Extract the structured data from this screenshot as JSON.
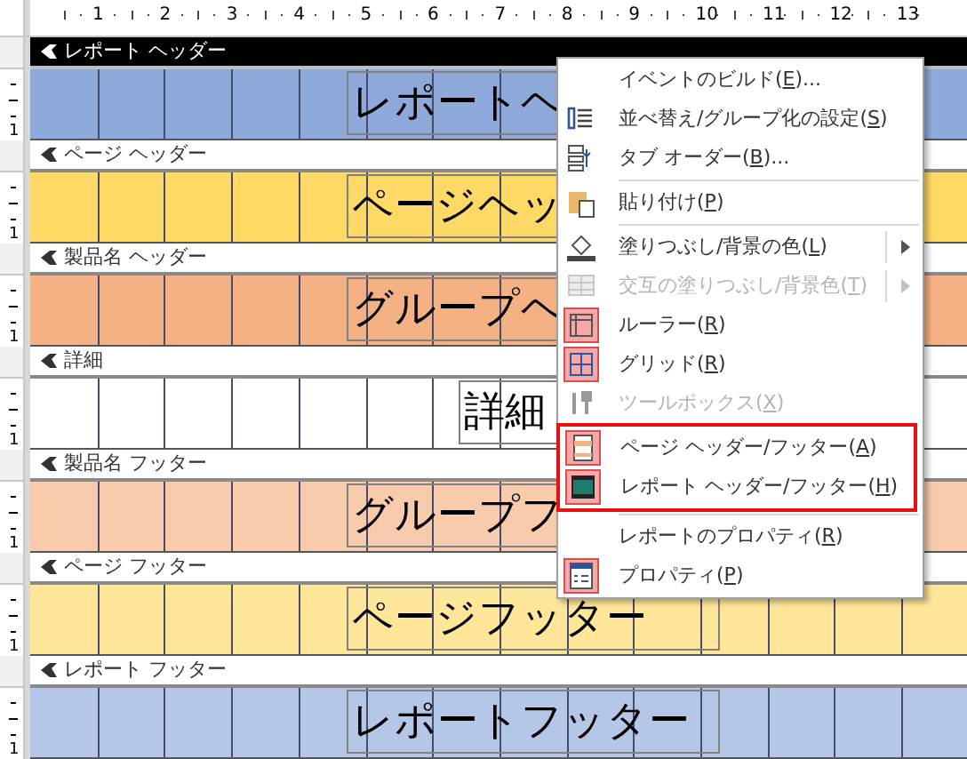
{
  "ruler": {
    "numbers": [
      "1",
      "2",
      "3",
      "4",
      "5",
      "6",
      "7",
      "8",
      "9",
      "10",
      "11",
      "12",
      "13"
    ]
  },
  "sections": [
    {
      "title": "レポート ヘッダー",
      "selected": true,
      "color": "#8eaadb",
      "label": "レポートヘ",
      "ruler_mark": "1"
    },
    {
      "title": "ページ ヘッダー",
      "selected": false,
      "color": "#ffd966",
      "label": "ページヘッ",
      "ruler_mark": "1"
    },
    {
      "title": "製品名 ヘッダー",
      "selected": false,
      "color": "#f4b183",
      "label": "グループヘ",
      "ruler_mark": "1"
    },
    {
      "title": "詳細",
      "selected": false,
      "color": "#ffffff",
      "label": "詳細",
      "ruler_mark": "1"
    },
    {
      "title": "製品名 フッター",
      "selected": false,
      "color": "#f8cbad",
      "label": "グループフ",
      "ruler_mark": "1"
    },
    {
      "title": "ページ フッター",
      "selected": false,
      "color": "#ffe699",
      "label": "ページフッター",
      "ruler_mark": "1"
    },
    {
      "title": "レポート フッター",
      "selected": false,
      "color": "#b4c7e7",
      "label": "レポートフッター",
      "ruler_mark": "1"
    }
  ],
  "context_menu": {
    "items": [
      {
        "kind": "item",
        "label": "イベントのビルド(",
        "key": "E",
        "suffix": ")...",
        "checked": false,
        "disabled": false,
        "submenu": false,
        "highlighted": false
      },
      {
        "kind": "item",
        "label": "並べ替え/グループ化の設定(",
        "key": "S",
        "suffix": ")",
        "checked": false,
        "disabled": false,
        "submenu": false,
        "highlighted": false
      },
      {
        "kind": "item",
        "label": "タブ オーダー(",
        "key": "B",
        "suffix": ")...",
        "checked": false,
        "disabled": false,
        "submenu": false,
        "highlighted": false
      },
      {
        "kind": "separator"
      },
      {
        "kind": "item",
        "label": "貼り付け(",
        "key": "P",
        "suffix": ")",
        "checked": false,
        "disabled": false,
        "submenu": false,
        "highlighted": false
      },
      {
        "kind": "separator"
      },
      {
        "kind": "item",
        "label": "塗りつぶし/背景の色(",
        "key": "L",
        "suffix": ")",
        "checked": false,
        "disabled": false,
        "submenu": true,
        "highlighted": false
      },
      {
        "kind": "item",
        "label": "交互の塗りつぶし/背景色(",
        "key": "T",
        "suffix": ")",
        "checked": false,
        "disabled": true,
        "submenu": true,
        "highlighted": false
      },
      {
        "kind": "item",
        "label": "ルーラー(",
        "key": "R",
        "suffix": ")",
        "checked": true,
        "disabled": false,
        "submenu": false,
        "highlighted": false
      },
      {
        "kind": "item",
        "label": "グリッド(",
        "key": "R",
        "suffix": ")",
        "checked": true,
        "disabled": false,
        "submenu": false,
        "highlighted": false
      },
      {
        "kind": "item",
        "label": "ツールボックス(",
        "key": "X",
        "suffix": ")",
        "checked": false,
        "disabled": true,
        "submenu": false,
        "highlighted": false
      },
      {
        "kind": "item",
        "label": "ページ ヘッダー/フッター(",
        "key": "A",
        "suffix": ")",
        "checked": true,
        "disabled": false,
        "submenu": false,
        "highlighted": true
      },
      {
        "kind": "item",
        "label": "レポート ヘッダー/フッター(",
        "key": "H",
        "suffix": ")",
        "checked": true,
        "disabled": false,
        "submenu": false,
        "highlighted": true
      },
      {
        "kind": "separator"
      },
      {
        "kind": "item",
        "label": "レポートのプロパティ(",
        "key": "R",
        "suffix": ")",
        "checked": false,
        "disabled": false,
        "submenu": false,
        "highlighted": false
      },
      {
        "kind": "item",
        "label": "プロパティ(",
        "key": "P",
        "suffix": ")",
        "checked": true,
        "disabled": false,
        "submenu": false,
        "highlighted": false
      }
    ]
  }
}
